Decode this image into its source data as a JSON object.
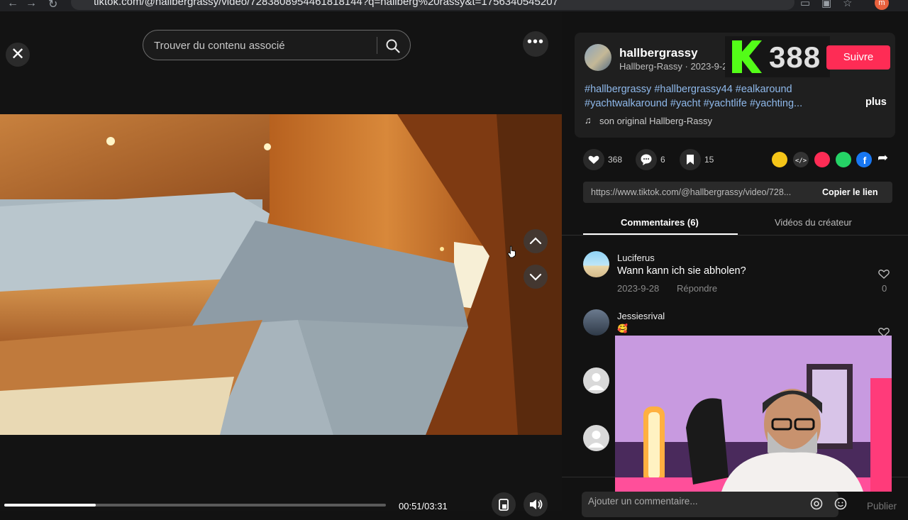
{
  "browser": {
    "url": "tiktok.com/@hallbergrassy/video/7283808954461818144?q=hallberg%20rassy&t=1756340545207",
    "profile_initial": "m"
  },
  "player": {
    "search_placeholder": "Trouver du contenu associé",
    "time": "00:51/03:31",
    "progress": 0.24
  },
  "overlay": {
    "counter": "388"
  },
  "creator": {
    "username": "hallbergrassy",
    "nickname": "Hallberg-Rassy",
    "date": "2023-9-28",
    "follow_label": "Suivre",
    "hashtags_line1": "#hallbergrassy #hallbergrassy44 #ealkaround",
    "hashtags_line2": "#yachtwalkaround #yacht #yachtlife #yachting...",
    "more_label": "plus",
    "music": "son original Hallberg-Rassy"
  },
  "stats": {
    "likes": "368",
    "comments": "6",
    "saves": "15"
  },
  "link": {
    "url": "https://www.tiktok.com/@hallbergrassy/video/728...",
    "copy_label": "Copier le lien"
  },
  "tabs": {
    "comments": "Commentaires (6)",
    "videos": "Vidéos du créateur"
  },
  "comments": [
    {
      "user": "Luciferus",
      "text": "Wann kann ich sie abholen?",
      "date": "2023-9-28",
      "reply": "Répondre",
      "likes": "0"
    },
    {
      "user": "Jessiesrival",
      "text": "🥰"
    }
  ],
  "comment_box": {
    "placeholder": "Ajouter un commentaire...",
    "publish": "Publier"
  },
  "colors": {
    "accent": "#fe2c55",
    "hashtag": "#8fb9eb"
  }
}
